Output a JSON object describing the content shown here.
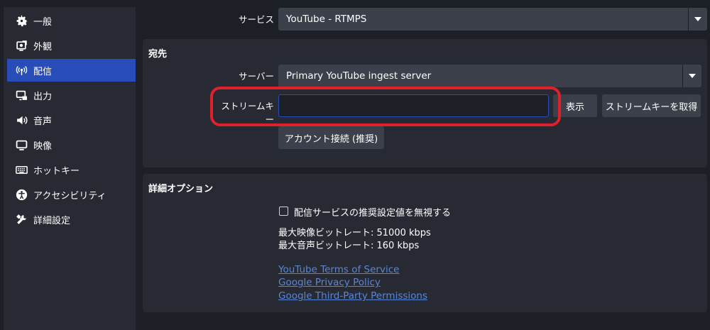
{
  "sidebar": {
    "items": [
      {
        "label": "一般",
        "icon": "gear-icon",
        "active": false
      },
      {
        "label": "外観",
        "icon": "appearance-icon",
        "active": false
      },
      {
        "label": "配信",
        "icon": "broadcast-icon",
        "active": true
      },
      {
        "label": "出力",
        "icon": "output-icon",
        "active": false
      },
      {
        "label": "音声",
        "icon": "speaker-icon",
        "active": false
      },
      {
        "label": "映像",
        "icon": "monitor-icon",
        "active": false
      },
      {
        "label": "ホットキー",
        "icon": "keyboard-icon",
        "active": false
      },
      {
        "label": "アクセシビリティ",
        "icon": "accessibility-icon",
        "active": false
      },
      {
        "label": "詳細設定",
        "icon": "tools-icon",
        "active": false
      }
    ]
  },
  "service": {
    "label": "サービス",
    "value": "YouTube - RTMPS"
  },
  "destination": {
    "title": "宛先",
    "server_label": "サーバー",
    "server_value": "Primary YouTube ingest server",
    "stream_key_label": "ストリームキー",
    "stream_key_value": "",
    "show_button": "表示",
    "get_key_button": "ストリームキーを取得",
    "connect_account_button": "アカウント接続 (推奨)"
  },
  "advanced": {
    "title": "詳細オプション",
    "ignore_checkbox_label": "配信サービスの推奨設定値を無視する",
    "ignore_checked": false,
    "max_video_bitrate": "最大映像ビットレート: 51000 kbps",
    "max_audio_bitrate": "最大音声ビットレート: 160 kbps",
    "links": [
      "YouTube Terms of Service",
      "Google Privacy Policy",
      "Google Third-Party Permissions"
    ]
  },
  "colors": {
    "accent": "#284cb8",
    "highlight": "#e0202a",
    "link": "#5a86d6"
  }
}
